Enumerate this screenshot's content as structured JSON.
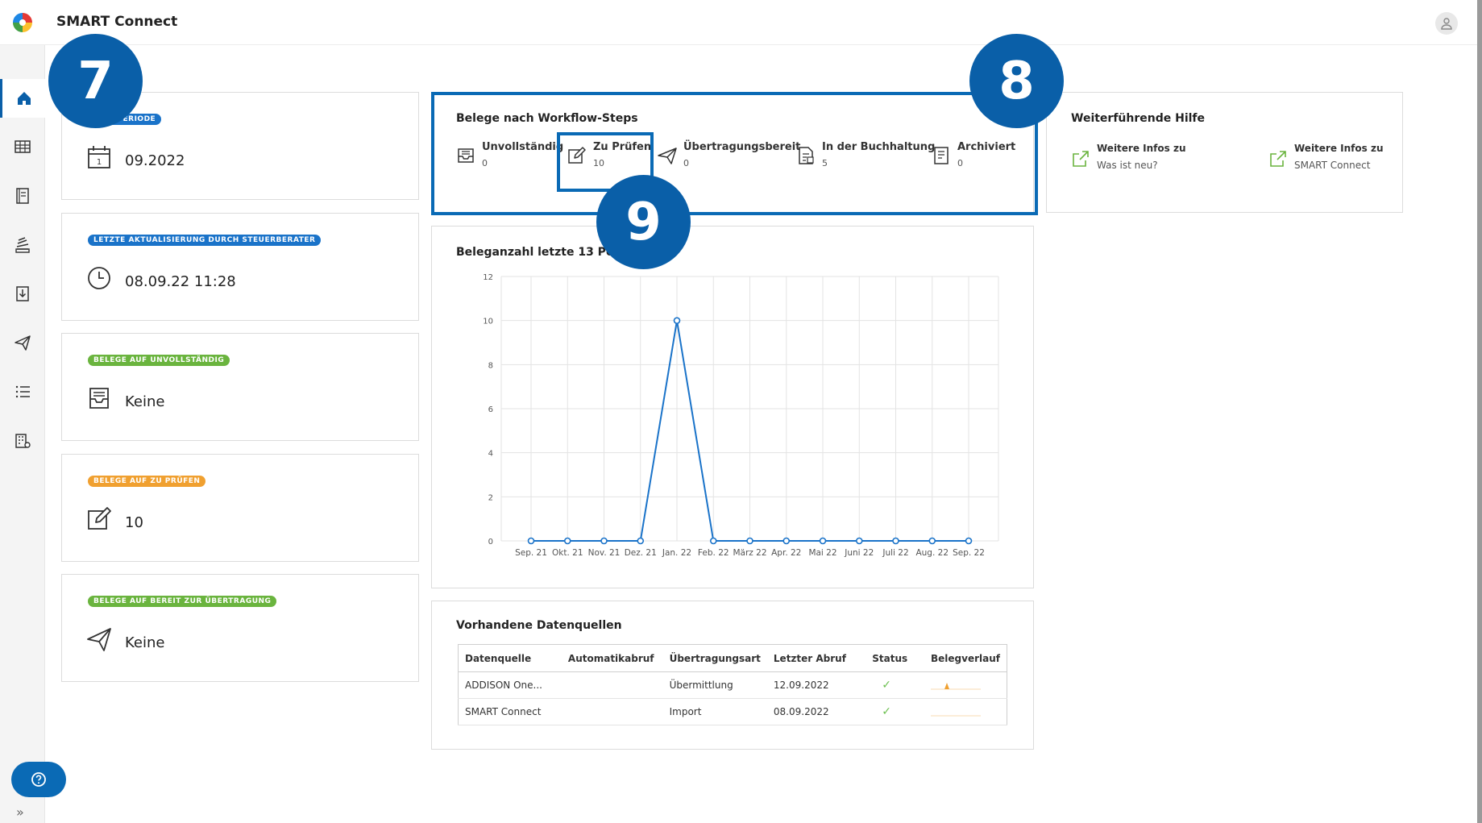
{
  "app": {
    "title": "SMART Connect"
  },
  "sidebar": {
    "items": [
      {
        "icon": "home-icon",
        "active": true
      },
      {
        "icon": "table-icon"
      },
      {
        "icon": "document-icon"
      },
      {
        "icon": "stack-icon"
      },
      {
        "icon": "download-icon"
      },
      {
        "icon": "send-icon"
      },
      {
        "icon": "list-icon"
      },
      {
        "icon": "building-settings-icon"
      }
    ],
    "help_icon": "help-icon",
    "expand_label": "»"
  },
  "cards": [
    {
      "badge": "AKTUELLE PERIODE",
      "badge_visible": "ELLE PERIODE",
      "badge_color": "#1a73c9",
      "value": "09.2022",
      "icon": "calendar-icon"
    },
    {
      "badge": "LETZTE AKTUALISIERUNG DURCH STEUERBERATER",
      "badge_color": "#1a73c9",
      "value": "08.09.22 11:28",
      "icon": "clock-icon"
    },
    {
      "badge": "BELEGE AUF UNVOLLSTÄNDIG",
      "badge_color": "#6ab43e",
      "value": "Keine",
      "icon": "inbox-icon"
    },
    {
      "badge": "BELEGE AUF ZU PRÜFEN",
      "badge_color": "#f0a030",
      "value": "10",
      "icon": "edit-icon"
    },
    {
      "badge": "BELEGE AUF BEREIT ZUR ÜBERTRAGUNG",
      "badge_color": "#6ab43e",
      "value": "Keine",
      "icon": "send-icon"
    }
  ],
  "workflow": {
    "title": "Belege nach Workflow-Steps",
    "steps": [
      {
        "label": "Unvollständig",
        "count": "0",
        "icon": "inbox-icon"
      },
      {
        "label": "Zu Prüfen",
        "count": "10",
        "icon": "edit-icon"
      },
      {
        "label": "Übertragungsbereit",
        "count": "0",
        "icon": "send-icon"
      },
      {
        "label": "In der Buchhaltung",
        "count": "5",
        "icon": "ledger-icon"
      },
      {
        "label": "Archiviert",
        "count": "0",
        "icon": "archive-icon"
      }
    ]
  },
  "help": {
    "title": "Weiterführende Hilfe",
    "links": [
      {
        "line1": "Weitere Infos zu",
        "line2": "Was ist neu?"
      },
      {
        "line1": "Weitere Infos zu",
        "line2": "SMART Connect"
      }
    ]
  },
  "callouts": {
    "c7": "7",
    "c8": "8",
    "c9": "9"
  },
  "chart_title": "Beleganzahl letzte 13 Perioden",
  "chart_data": {
    "type": "line",
    "title": "Beleganzahl letzte 13 Perioden",
    "categories": [
      "Sep. 21",
      "Okt. 21",
      "Nov. 21",
      "Dez. 21",
      "Jan. 22",
      "Feb. 22",
      "März 22",
      "Apr. 22",
      "Mai 22",
      "Juni 22",
      "Juli 22",
      "Aug. 22",
      "Sep. 22"
    ],
    "values": [
      0,
      0,
      0,
      0,
      10,
      0,
      0,
      0,
      0,
      0,
      0,
      0,
      0
    ],
    "yticks": [
      "0",
      "2",
      "4",
      "6",
      "8",
      "10",
      "12"
    ],
    "ylim": [
      0,
      12
    ],
    "grid": true,
    "color": "#1a73c9"
  },
  "datasources": {
    "title": "Vorhandene Datenquellen",
    "columns": [
      "Datenquelle",
      "Automatikabruf",
      "Übertragungsart",
      "Letzter Abruf",
      "Status",
      "Belegverlauf"
    ],
    "rows": [
      {
        "source": "ADDISON One...",
        "auto": "",
        "type": "Übermittlung",
        "last": "12.09.2022",
        "status": "✓",
        "trend": "spike"
      },
      {
        "source": "SMART Connect",
        "auto": "",
        "type": "Import",
        "last": "08.09.2022",
        "status": "✓",
        "trend": "flat"
      }
    ]
  }
}
